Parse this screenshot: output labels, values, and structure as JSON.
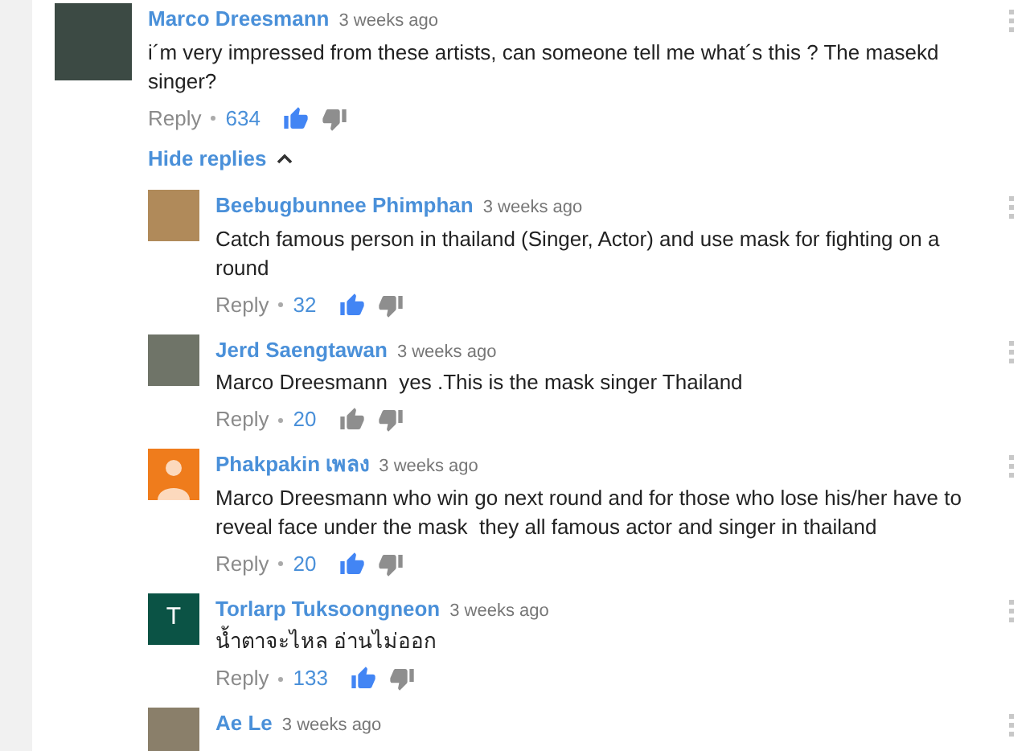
{
  "comment": {
    "author": "Marco Dreesmann",
    "time": "3 weeks ago",
    "avatar": {
      "kind": "photo"
    },
    "text": "i´m very impressed from these artists, can someone tell me what´s this ? The masekd singer?",
    "reply": "Reply",
    "likes": "634",
    "liked": true,
    "replies_toggle": {
      "label": "Hide replies",
      "expanded": true
    }
  },
  "replies": [
    {
      "author": "Beebugbunnee Phimphan",
      "time": "3 weeks ago",
      "avatar": {
        "kind": "photo",
        "color": "#b08a5a"
      },
      "text": "Catch famous person in thailand (Singer, Actor) and use mask for fighting on a round",
      "reply": "Reply",
      "likes": "32",
      "liked": true
    },
    {
      "author": "Jerd Saengtawan",
      "time": "3 weeks ago",
      "avatar": {
        "kind": "photo",
        "color": "#6f7468"
      },
      "text": "Marco Dreesmann  yes .This is the mask singer Thailand",
      "reply": "Reply",
      "likes": "20",
      "liked": false
    },
    {
      "author": "Phakpakin เพลง",
      "time": "3 weeks ago",
      "avatar": {
        "kind": "default",
        "color": "#ef7c1c"
      },
      "text": "Marco Dreesmann who win go next round and for those who lose his/her have to reveal face under the mask  they all famous actor and singer in thailand",
      "reply": "Reply",
      "likes": "20",
      "liked": true
    },
    {
      "author": "Torlarp Tuksoongneon",
      "time": "3 weeks ago",
      "avatar": {
        "kind": "letter",
        "letter": "T",
        "color": "#0b5345"
      },
      "text": "น้ำตาจะไหล อ่านไม่ออก",
      "reply": "Reply",
      "likes": "133",
      "liked": true
    },
    {
      "author": "Ae Le",
      "time": "3 weeks ago",
      "avatar": {
        "kind": "photo",
        "color": "#8a7f6a"
      }
    }
  ]
}
